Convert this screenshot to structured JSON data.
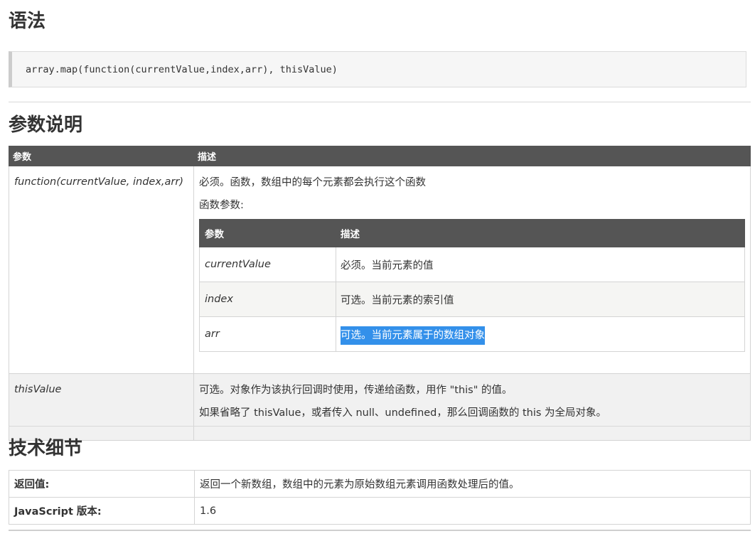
{
  "sections": {
    "syntax_title": "语法",
    "params_title": "参数说明",
    "tech_title": "技术细节"
  },
  "syntax": {
    "code": "array.map(function(currentValue,index,arr), thisValue)"
  },
  "params_table": {
    "headers": [
      "参数",
      "描述"
    ],
    "rows": [
      {
        "name": "function(currentValue, index,arr)",
        "desc_lines": [
          "必须。函数，数组中的每个元素都会执行这个函数",
          "函数参数:"
        ],
        "sub_table": {
          "headers": [
            "参数",
            "描述"
          ],
          "rows": [
            {
              "name": "currentValue",
              "desc": "必须。当前元素的值"
            },
            {
              "name": "index",
              "desc": "可选。当前元素的索引值"
            },
            {
              "name": "arr",
              "desc": "可选。当前元素属于的数组对象",
              "selected": true
            }
          ]
        }
      },
      {
        "name": "thisValue",
        "desc_lines": [
          "可选。对象作为该执行回调时使用，传递给函数，用作 \"this\" 的值。",
          "如果省略了 thisValue，或者传入 null、undefined，那么回调函数的 this 为全局对象。"
        ]
      }
    ]
  },
  "tech_table": {
    "rows": [
      {
        "key": "返回值:",
        "value": "返回一个新数组，数组中的元素为原始数组元素调用函数处理后的值。"
      },
      {
        "key": "JavaScript 版本:",
        "value": "1.6"
      }
    ]
  },
  "colors": {
    "header_bg": "#555555",
    "selection": "#3390ea",
    "code_bg": "#f6f6f6"
  }
}
